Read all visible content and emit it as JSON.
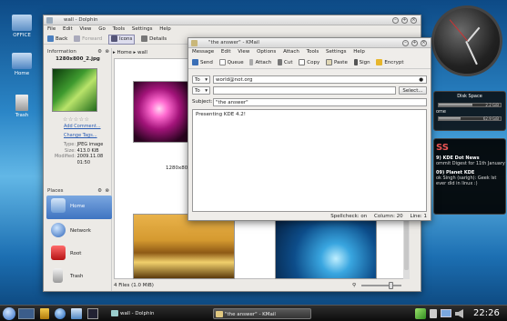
{
  "desktop": {
    "icons": [
      {
        "label": "OFFICE"
      },
      {
        "label": "Home"
      },
      {
        "label": "Trash"
      }
    ],
    "disk_widget": {
      "title": "Disk Space",
      "bars": [
        {
          "label": "2.2 GiB",
          "fraction": 0.55
        },
        {
          "label": "62.9 GiB",
          "fraction": 0.35
        }
      ],
      "row_label": "ome"
    },
    "news_widget": {
      "header": "SS",
      "items": [
        {
          "title": "9) KDE Dot News",
          "text": "ommit Digest for 11th January"
        },
        {
          "title": "09) Planet KDE",
          "text": "ok Singh (sarigh): Geek lst",
          "text2": "ever did in linux :)"
        }
      ]
    }
  },
  "dolphin": {
    "title": "wall - Dolphin",
    "menu": [
      "File",
      "Edit",
      "View",
      "Go",
      "Tools",
      "Settings",
      "Help"
    ],
    "toolbar": {
      "back": "Back",
      "forward": "Forward",
      "icons": "Icons",
      "details": "Details"
    },
    "breadcrumb": {
      "root": "Home",
      "current": "wall"
    },
    "info": {
      "panel_title": "Information",
      "filename": "1280x800_2.jpg",
      "add_comment": "Add Comment...",
      "change_tags": "Change Tags...",
      "meta": [
        {
          "k": "Type:",
          "v": "JPEG image"
        },
        {
          "k": "Size:",
          "v": "413.0 KiB"
        },
        {
          "k": "Modified:",
          "v": "2009.11.08"
        },
        {
          "k": "",
          "v": "01:50"
        }
      ]
    },
    "places": {
      "panel_title": "Places",
      "items": [
        "Home",
        "Network",
        "Root",
        "Trash"
      ]
    },
    "file_labels": [
      "1280x800"
    ],
    "status": "4 Files (1.0 MiB)"
  },
  "kmail": {
    "title": "\"the answer\" - KMail",
    "menu": [
      "Message",
      "Edit",
      "View",
      "Options",
      "Attach",
      "Tools",
      "Settings",
      "Help"
    ],
    "toolbar": [
      "Send",
      "Queue",
      "Attach",
      "Cut",
      "Copy",
      "Paste",
      "Sign",
      "Encrypt"
    ],
    "to_label": "To",
    "to_value": "world@not.org",
    "to2_label": "To",
    "select_button": "Select...",
    "subject_label": "Subject:",
    "subject_value": "\"the answer\"",
    "body": "Presenting KDE 4.2!",
    "statusbar": {
      "spell": "Spellcheck: on",
      "column": "Column: 20",
      "line": "Line: 1"
    }
  },
  "taskbar": {
    "tasks": [
      "wall - Dolphin",
      "\"the answer\" - KMail"
    ],
    "clock": "22:26"
  }
}
